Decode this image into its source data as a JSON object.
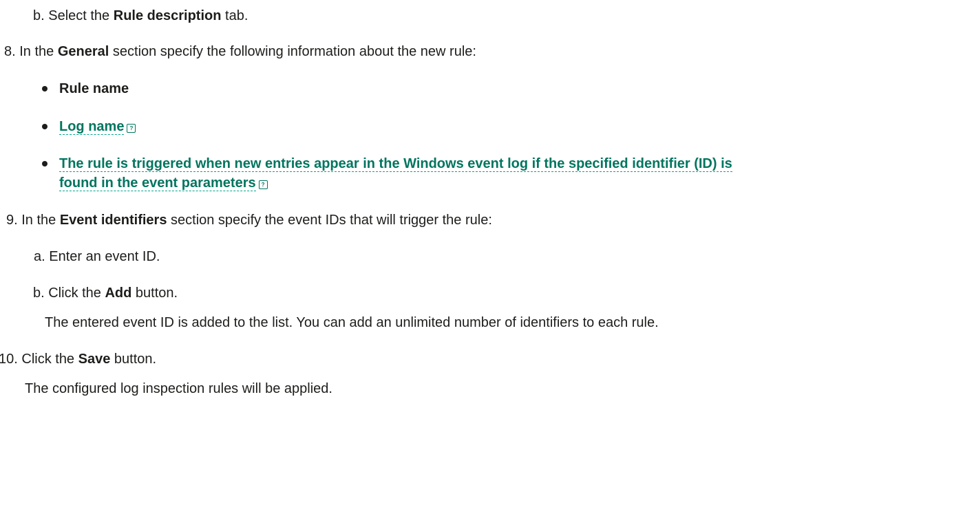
{
  "step7b": {
    "prefix": "b. Select the ",
    "bold": "Rule description",
    "suffix": " tab."
  },
  "step8": {
    "num": "8.",
    "prefix": " In the ",
    "bold": "General",
    "suffix": " section specify the following information about the new rule:",
    "bullets": {
      "rule_name": "Rule name",
      "log_name": "Log name",
      "trigger_line1": "The rule is triggered when new entries appear in the Windows event log if the specified identifier (ID) is",
      "trigger_line2": "found in the event parameters"
    }
  },
  "step9": {
    "num": "9.",
    "prefix": " In the ",
    "bold": "Event identifiers",
    "suffix": " section specify the event IDs that will trigger the rule:",
    "a": "a. Enter an event ID.",
    "b": {
      "prefix": "b. Click the ",
      "bold": "Add",
      "suffix": " button."
    },
    "b_note": "The entered event ID is added to the list. You can add an unlimited number of identifiers to each rule."
  },
  "step10": {
    "num": "10.",
    "prefix": " Click the ",
    "bold": "Save",
    "suffix": " button.",
    "note": "The configured log inspection rules will be applied."
  },
  "icons": {
    "help": "?"
  },
  "colors": {
    "text": "#1d1d1b",
    "link": "#00755f"
  }
}
